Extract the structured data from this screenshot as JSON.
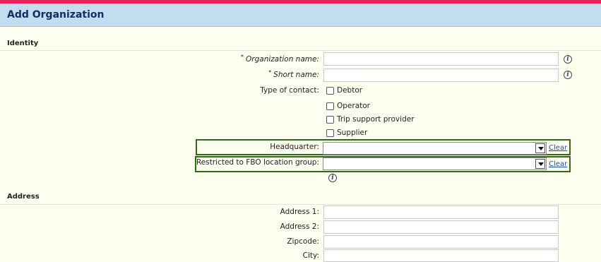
{
  "header": {
    "title": "Add Organization"
  },
  "identity": {
    "section_title": "Identity",
    "required_mark": "*",
    "organization_name": {
      "label": "Organization name:",
      "value": ""
    },
    "short_name": {
      "label": "Short name:",
      "value": ""
    },
    "type_of_contact": {
      "label": "Type of contact:",
      "options": [
        {
          "label": "Debtor",
          "checked": false
        },
        {
          "label": "Operator",
          "checked": false
        },
        {
          "label": "Trip support provider",
          "checked": false
        },
        {
          "label": "Supplier",
          "checked": false
        }
      ]
    },
    "headquarter": {
      "label": "Headquarter:",
      "value": "",
      "clear_label": "Clear"
    },
    "restricted": {
      "label": "Restricted to FBO location group:",
      "value": "",
      "clear_label": "Clear"
    }
  },
  "address": {
    "section_title": "Address",
    "fields": [
      {
        "label": "Address 1:",
        "value": ""
      },
      {
        "label": "Address 2:",
        "value": ""
      },
      {
        "label": "Zipcode:",
        "value": ""
      },
      {
        "label": "City:",
        "value": ""
      }
    ]
  },
  "icons": {
    "info": "info-icon",
    "dropdown": "chevron-down-icon"
  },
  "colors": {
    "accent_bar": "#e8205a",
    "title_bar": "#c3ddf0",
    "title_text": "#0d2f63",
    "highlight": "#2f6b10",
    "link": "#1a4fb5"
  }
}
